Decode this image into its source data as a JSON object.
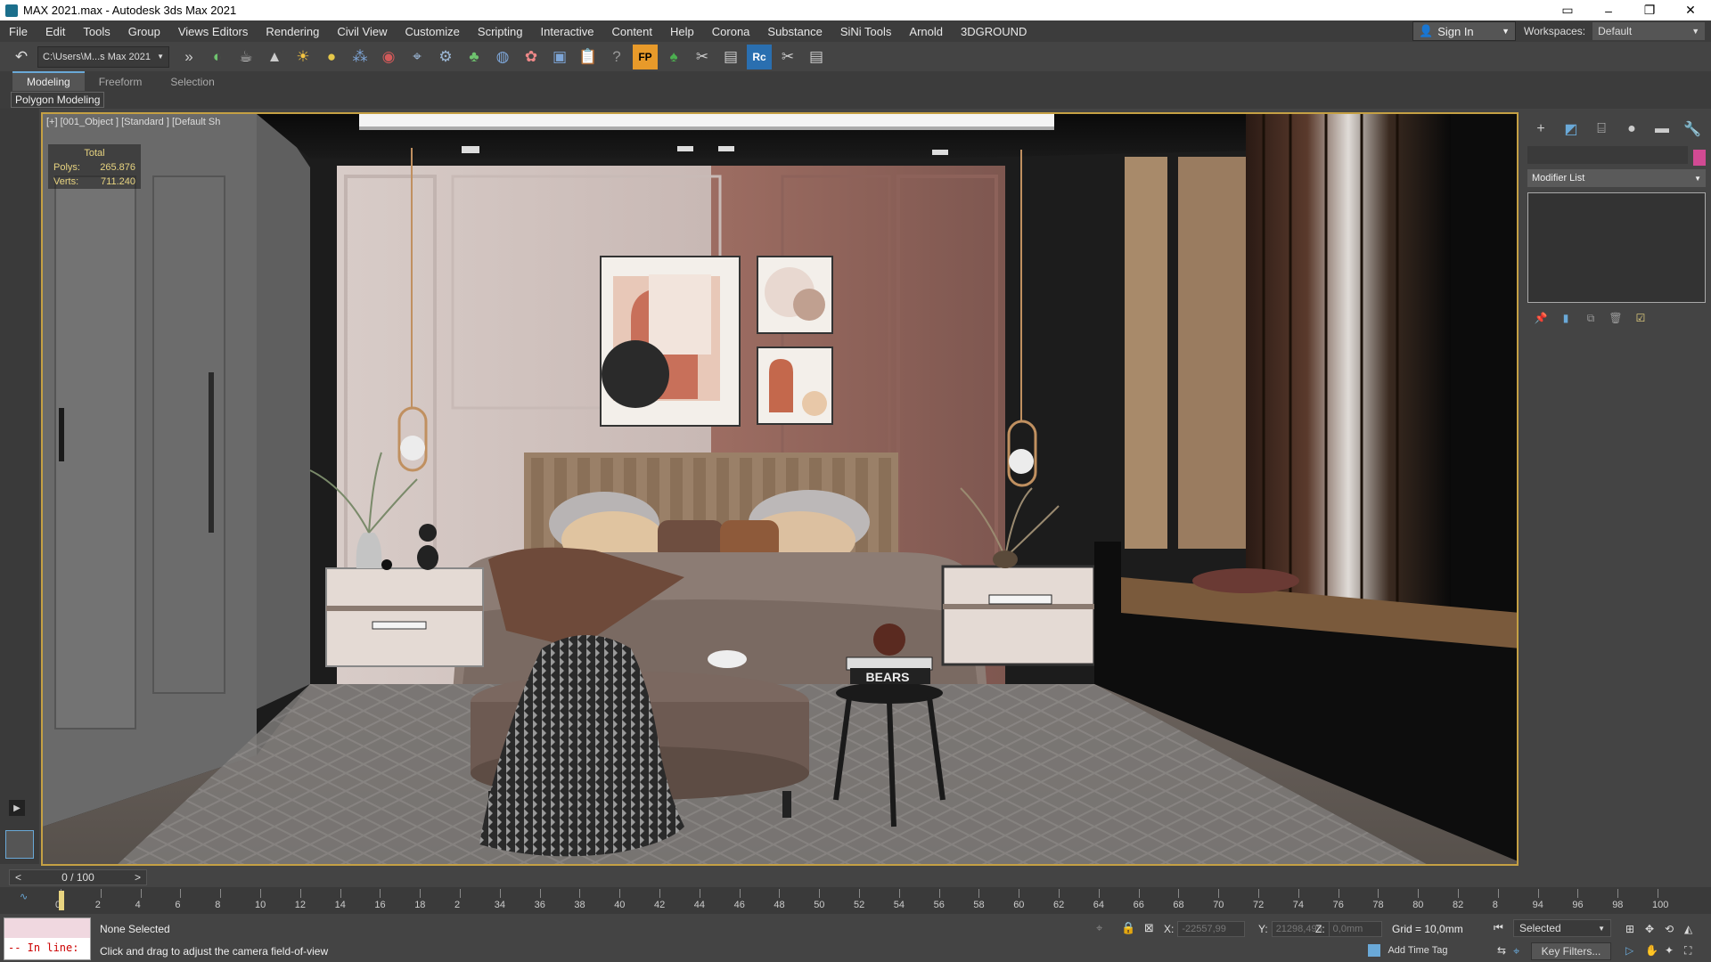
{
  "window": {
    "title": "MAX 2021.max - Autodesk 3ds Max 2021"
  },
  "menu": [
    "File",
    "Edit",
    "Tools",
    "Group",
    "Views Editors",
    "Rendering",
    "Civil View",
    "Customize",
    "Scripting",
    "Interactive",
    "Content",
    "Help",
    "Corona",
    "Substance",
    "SiNi Tools",
    "Arnold",
    "3DGROUND"
  ],
  "signin": {
    "label": "Sign In"
  },
  "workspaces": {
    "label": "Workspaces:",
    "value": "Default"
  },
  "toolbar": {
    "path": "C:\\Users\\M...s Max 2021"
  },
  "ribbon": {
    "tabs": [
      "Modeling",
      "Freeform",
      "Selection"
    ],
    "active_tab": "Modeling",
    "panel": "Polygon Modeling"
  },
  "viewport": {
    "label": "[+] [001_Object ] [Standard ] [Default Sh",
    "stats": {
      "header": "Total",
      "polys_label": "Polys:",
      "polys_value": "265.876",
      "verts_label": "Verts:",
      "verts_value": "711.240"
    },
    "poster_text": "BEARS"
  },
  "command_panel": {
    "modifier_list": "Modifier List",
    "color": "#d14a93"
  },
  "timeline": {
    "frame": "0 / 100",
    "prev": "<",
    "next": ">",
    "ticks": [
      "0",
      "2",
      "4",
      "6",
      "8",
      "10",
      "12",
      "14",
      "16",
      "18",
      "2",
      "34",
      "36",
      "38",
      "40",
      "42",
      "44",
      "46",
      "48",
      "50",
      "52",
      "54",
      "56",
      "58",
      "60",
      "62",
      "64",
      "66",
      "68",
      "70",
      "72",
      "74",
      "76",
      "78",
      "80",
      "82",
      "8",
      "94",
      "96",
      "98",
      "100"
    ]
  },
  "status": {
    "selection": "None Selected",
    "prompt": "Click and drag to adjust the camera field-of-view",
    "maxscript": "-- In line:",
    "x_label": "X:",
    "x_value": "-22557,99",
    "y_label": "Y:",
    "y_value": "21298,498",
    "z_label": "Z:",
    "z_value": "0,0mm",
    "grid": "Grid = 10,0mm",
    "add_time_tag": "Add Time Tag",
    "selected_dropdown": "Selected",
    "key_filters": "Key Filters..."
  }
}
